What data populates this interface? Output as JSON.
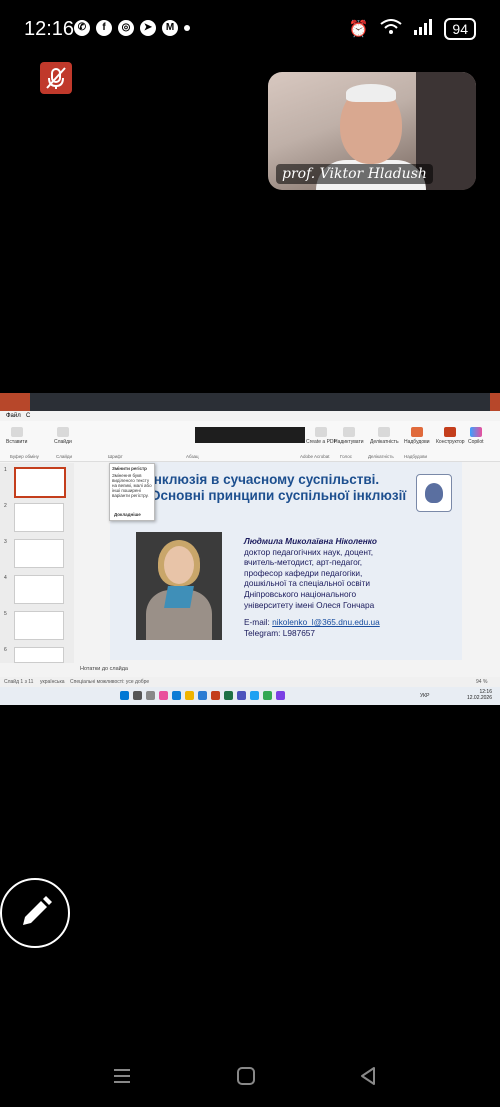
{
  "status_bar": {
    "time": "12:16",
    "apps": [
      "viber-icon",
      "facebook-icon",
      "instagram-icon",
      "telegram-icon",
      "gmail-icon"
    ],
    "battery": "94"
  },
  "call": {
    "participant_name": "prof. Viktor Hladush"
  },
  "ppt": {
    "tabs": [
      "Файл",
      "С"
    ],
    "ribbon_groups": [
      "Буфер обміну",
      "Слайди",
      "Шрифт",
      "Абзац",
      "Adobe Acrobat",
      "Голос",
      "Делікатність",
      "Надбудови"
    ],
    "ribbon_buttons": {
      "paste": "Вставити",
      "slides": "Слайди",
      "create_pdf": "Create a PDF",
      "dictate": "Надиктувати",
      "sensitivity": "Делікатність",
      "addins": "Надбудови",
      "designer": "Конструктор",
      "copilot": "Copilot"
    },
    "tooltip": {
      "title": "Змінити регістр",
      "text": "Змінення букв виділеного тексту на великі, малі або інші поширені варіанти регістру.",
      "link": "Докладніше"
    },
    "thumbnail_numbers": [
      "1",
      "2",
      "3",
      "4",
      "5",
      "6"
    ],
    "slide": {
      "title_line1": "Інклюзія в сучасному суспільстві.",
      "title_line2": "Основні принципи суспільної інклюзії",
      "bio_name": "Людмила Миколаївна Ніколенко",
      "bio_lines": [
        "доктор педагогічних наук, доцент,",
        "вчитель-методист, арт-педагог,",
        "професор кафедри педагогіки,",
        "дошкільної та спеціальної освіти",
        "Дніпровського національного",
        "університету імені Олеся Гончара"
      ],
      "email_label": "E-mail:",
      "email": "nikolenko_l@365.dnu.edu.ua",
      "telegram": "Telegram: L987657"
    },
    "notes_placeholder": "Нотатки до слайда",
    "status": {
      "slide_counter": "Слайд 1 з 11",
      "language": "українська",
      "accessibility": "Спеціальні можливості: усе добре",
      "zoom": "94 %"
    },
    "taskbar_clock": {
      "time": "12:16",
      "date": "12.02.2026"
    },
    "taskbar_lang": "УКР"
  }
}
